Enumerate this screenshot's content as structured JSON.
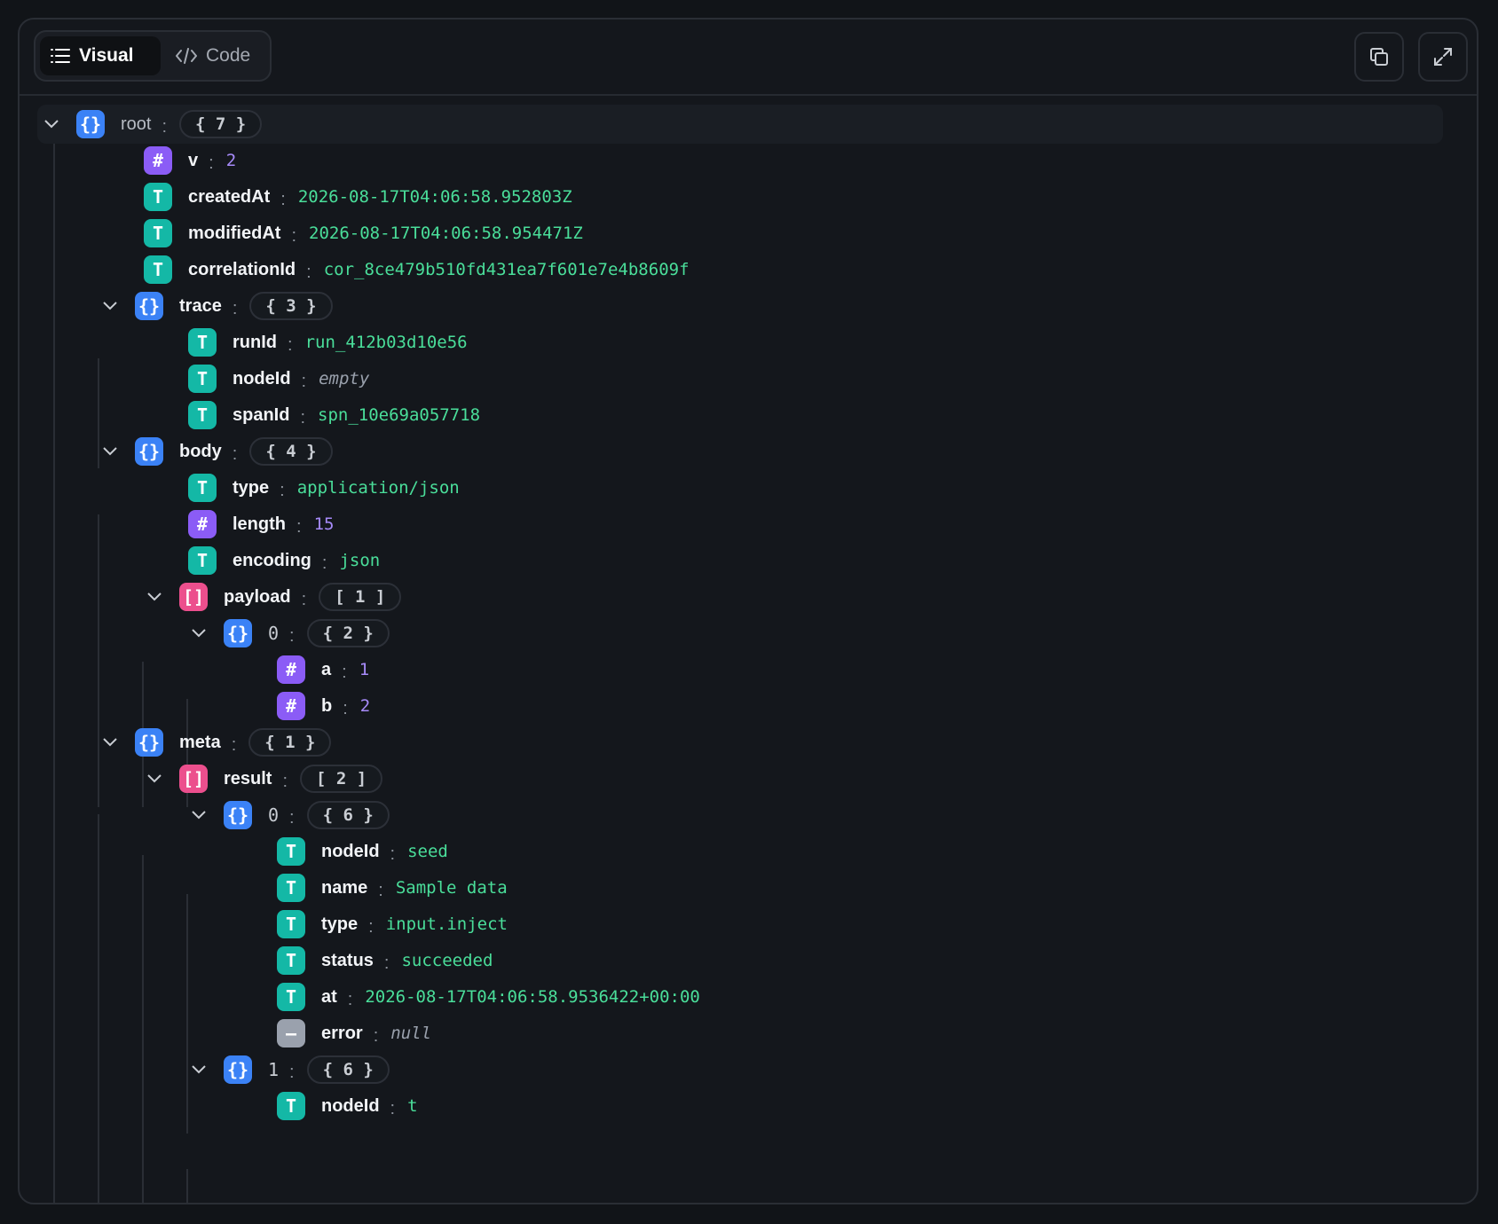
{
  "toolbar": {
    "visual_label": "Visual",
    "code_label": "Code",
    "copy_icon": "copy-icon",
    "expand_icon": "expand-icon"
  },
  "tree": {
    "root": {
      "key": "root",
      "count": "{ 7 }"
    },
    "v": {
      "key": "v",
      "value": "2"
    },
    "createdAt": {
      "key": "createdAt",
      "value": "2026-08-17T04:06:58.952803Z"
    },
    "modifiedAt": {
      "key": "modifiedAt",
      "value": "2026-08-17T04:06:58.954471Z"
    },
    "correlationId": {
      "key": "correlationId",
      "value": "cor_8ce479b510fd431ea7f601e7e4b8609f"
    },
    "trace": {
      "key": "trace",
      "count": "{ 3 }",
      "runId": {
        "key": "runId",
        "value": "run_412b03d10e56"
      },
      "nodeId": {
        "key": "nodeId",
        "value": "empty"
      },
      "spanId": {
        "key": "spanId",
        "value": "spn_10e69a057718"
      }
    },
    "body": {
      "key": "body",
      "count": "{ 4 }",
      "type": {
        "key": "type",
        "value": "application/json"
      },
      "length": {
        "key": "length",
        "value": "15"
      },
      "encoding": {
        "key": "encoding",
        "value": "json"
      },
      "payload": {
        "key": "payload",
        "count": "[ 1 ]",
        "item0": {
          "key": "0",
          "count": "{ 2 }",
          "a": {
            "key": "a",
            "value": "1"
          },
          "b": {
            "key": "b",
            "value": "2"
          }
        }
      }
    },
    "meta": {
      "key": "meta",
      "count": "{ 1 }",
      "result": {
        "key": "result",
        "count": "[ 2 ]",
        "item0": {
          "key": "0",
          "count": "{ 6 }",
          "nodeId": {
            "key": "nodeId",
            "value": "seed"
          },
          "name": {
            "key": "name",
            "value": "Sample data"
          },
          "type": {
            "key": "type",
            "value": "input.inject"
          },
          "status": {
            "key": "status",
            "value": "succeeded"
          },
          "at": {
            "key": "at",
            "value": "2026-08-17T04:06:58.9536422+00:00"
          },
          "error": {
            "key": "error",
            "value": "null"
          }
        },
        "item1": {
          "key": "1",
          "count": "{ 6 }",
          "nodeId": {
            "key": "nodeId",
            "value": "t"
          }
        }
      }
    }
  },
  "icons": {
    "object": "{}",
    "array": "[]",
    "number": "#",
    "string": "T",
    "null": "—"
  },
  "colors": {
    "background": "#111418",
    "object": "#3b82f6",
    "array": "#ec4f8d",
    "number": "#8b5cf6",
    "string": "#14b8a6",
    "null": "#9aa1ad",
    "string_value": "#4ade9a",
    "number_value": "#a78bfa"
  }
}
